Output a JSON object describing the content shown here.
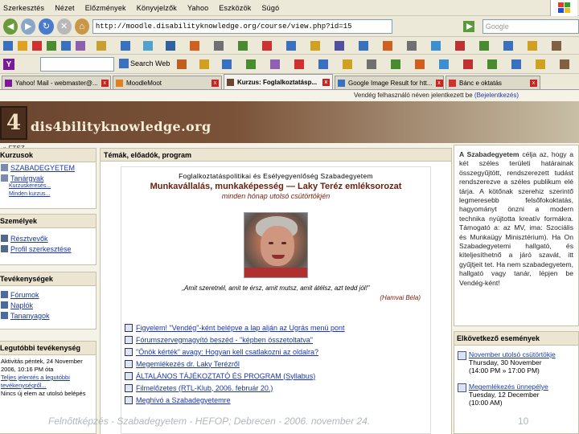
{
  "browser": {
    "menu": [
      "Szerkesztés",
      "Nézet",
      "Előzmények",
      "Könyvjelzők",
      "Yahoo",
      "Eszközök",
      "Súgó"
    ],
    "url": "http://moodle.disabilityknowledge.org/course/view.php?id=15",
    "search_placeholder": "Google",
    "search_web_label": "Search Web",
    "tabs": [
      {
        "label": "Yahoo! Mail - webmaster@...",
        "active": false
      },
      {
        "label": "MoodleMoot",
        "active": false
      },
      {
        "label": "Kurzus: Foglalkoztatásp...",
        "active": true
      },
      {
        "label": "Google Image Result for htt...",
        "active": false
      },
      {
        "label": "Bánc e oktatás",
        "active": false
      }
    ]
  },
  "site": {
    "login_text": "Vendég felhasználó néven jelentkezett be",
    "login_link": "(Bejelentkezés)",
    "name": "dis4bilityknowledge.org",
    "logo_glyph": "4",
    "breadcrumb": "» FTSZ"
  },
  "left": {
    "courses": {
      "title": "Kurzusok",
      "items": [
        "SZABADEGYETEM",
        "Tanárgyak"
      ],
      "subitems": [
        "Kurzuskeresés...",
        "Minden kurzus..."
      ]
    },
    "people": {
      "title": "Személyek",
      "items": [
        "Résztvevők",
        "Profil szerkesztése"
      ]
    },
    "activities": {
      "title": "Tevékenységek",
      "items": [
        "Fórumok",
        "Naplók",
        "Tananyagok"
      ]
    },
    "recent": {
      "title": "Legutóbbi tevékenység",
      "lines": [
        "Aktivitás péntek, 24 November",
        "2006, 10:16 PM óta",
        "Teljes jelentés a legutóbbi",
        "tevékenységről...",
        "Nincs új elem az utolsó belépés"
      ]
    }
  },
  "main": {
    "header": "Témák, előadók, program",
    "title1": "Foglalkoztatáspolitikai és Esélyegyenlőség Szabadegyetem",
    "title2": "Munkavállalás, munkaképesség — Laky Teréz emléksorozat",
    "title3": "minden hónap utolsó csütörtökjén",
    "quote": "„Amit szeretnél, amit te érsz, amit mutsz, amit átélsz, azt tedd jól!”",
    "quote_author": "(Hamvai Béla)",
    "items": [
      "Figyelem! \"Vendég\"-ként belépve a lap alján az Ugrás menü pont",
      "Fórumszervegmagyító beszéd - \"képben összetoltatva\"",
      "\"Önök kérték\" avagy: Hogyan kell csatlakozni az oldalra?",
      "Megemlékezés dr. Laky Terézről",
      "ÁLTALÁNOS TÁJÉKOZTATÓ ÉS PROGRAM (Syllabus)",
      "Filmelőzetes (RTL-Klub, 2006. február 20.)",
      "Meghívó a Szabadegyetemre"
    ]
  },
  "right": {
    "intro_html_parts": {
      "lead": "A Szabadegyetem",
      "body": "célja az, hogy a két széles területi határainak összegyűjtött, rendszerezett tudást rendszerezve a széles publikum elé tárja. A kötőnak szerehiz szerintő legmeresebb felsőfokoktatás, hagyományt önzni a modern technika nyújtotta kreatív formákra. Támogató a: az MV, ima: Szociális és Munkaügy Minisztérium). Ha On Szabadegyetemi hallgató, és kiteljesíthetnő a járó szavát, itt gyűjtjeit tet. Ha nem szabadegyetem, hallgató vagy tanár, lépjen be Vendég-ként!"
    },
    "events": {
      "title": "Elkövetkező események",
      "items": [
        {
          "title": "November utolsó csütörtökje",
          "date": "Thursday, 30 November",
          "time": "(14:00 PM » 17:00 PM)"
        },
        {
          "title": "Megemlékezés ünnepélye",
          "date": "Tuesday, 12 December",
          "time": "(10:00 AM)"
        }
      ]
    }
  },
  "slide": {
    "footer": "Felnőttképzés - Szabadegyetem - HEFOP; Debrecen - 2006. november 24.",
    "page": "10"
  }
}
